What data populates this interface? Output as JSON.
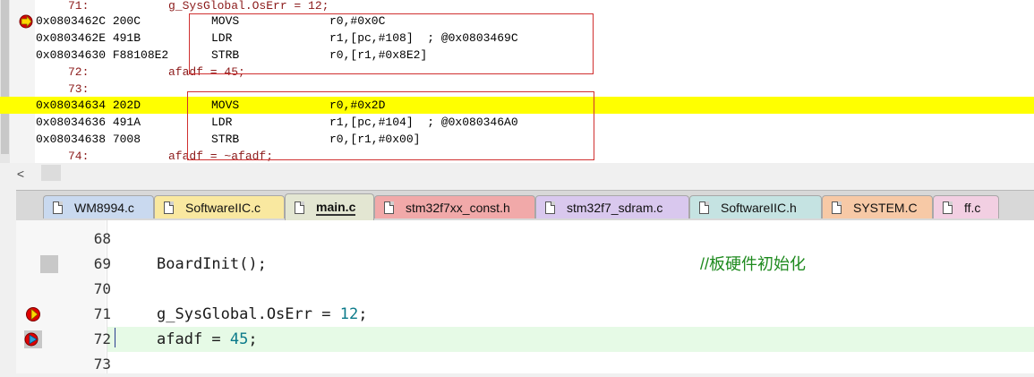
{
  "disassembly": {
    "lines": [
      {
        "kind": "src",
        "lineno": "71:",
        "code": "g_SysGlobal.OsErr = 12;"
      },
      {
        "kind": "asm",
        "addr": "0x0803462C 200C",
        "op": "MOVS",
        "args": "r0,#0x0C"
      },
      {
        "kind": "asm",
        "addr": "0x0803462E 491B",
        "op": "LDR",
        "args": "r1,[pc,#108]  ; @0x0803469C"
      },
      {
        "kind": "asm",
        "addr": "0x08034630 F88108E2",
        "op": "STRB",
        "args": "r0,[r1,#0x8E2]"
      },
      {
        "kind": "src",
        "lineno": "72:",
        "code": "afadf = 45;"
      },
      {
        "kind": "src",
        "lineno": "73:",
        "code": ""
      },
      {
        "kind": "asm",
        "addr": "0x08034634 202D",
        "op": "MOVS",
        "args": "r0,#0x2D"
      },
      {
        "kind": "asm",
        "addr": "0x08034636 491A",
        "op": "LDR",
        "args": "r1,[pc,#104]  ; @0x080346A0"
      },
      {
        "kind": "asm",
        "addr": "0x08034638 7008",
        "op": "STRB",
        "args": "r0,[r1,#0x00]"
      },
      {
        "kind": "src",
        "lineno": "74:",
        "code": "afadf = ~afadf;"
      }
    ],
    "scroll_left_glyph": "<"
  },
  "tabs": [
    {
      "label": "WM8994.c",
      "color": "#c9d9ef",
      "active": false
    },
    {
      "label": "SoftwareIIC.c",
      "color": "#f9e8a0",
      "active": false
    },
    {
      "label": "main.c",
      "color": "#e3e6d2",
      "active": true
    },
    {
      "label": "stm32f7xx_const.h",
      "color": "#f1a9a9",
      "active": false
    },
    {
      "label": "stm32f7_sdram.c",
      "color": "#d9c8ee",
      "active": false
    },
    {
      "label": "SoftwareIIC.h",
      "color": "#c5e3e2",
      "active": false
    },
    {
      "label": "SYSTEM.C",
      "color": "#f7c9a6",
      "active": false
    },
    {
      "label": "ff.c",
      "color": "#f2cfe2",
      "active": false
    }
  ],
  "editor": {
    "lines": [
      {
        "num": "68",
        "code": ""
      },
      {
        "num": "69",
        "code": "BoardInit();",
        "comment": "//板硬件初始化"
      },
      {
        "num": "70",
        "code": ""
      },
      {
        "num": "71",
        "code_prefix": "g_SysGlobal.OsErr = ",
        "code_num": "12",
        "code_suffix": ";"
      },
      {
        "num": "72",
        "code_prefix": "afadf = ",
        "code_num": "45",
        "code_suffix": ";"
      },
      {
        "num": "73",
        "code": ""
      }
    ]
  }
}
